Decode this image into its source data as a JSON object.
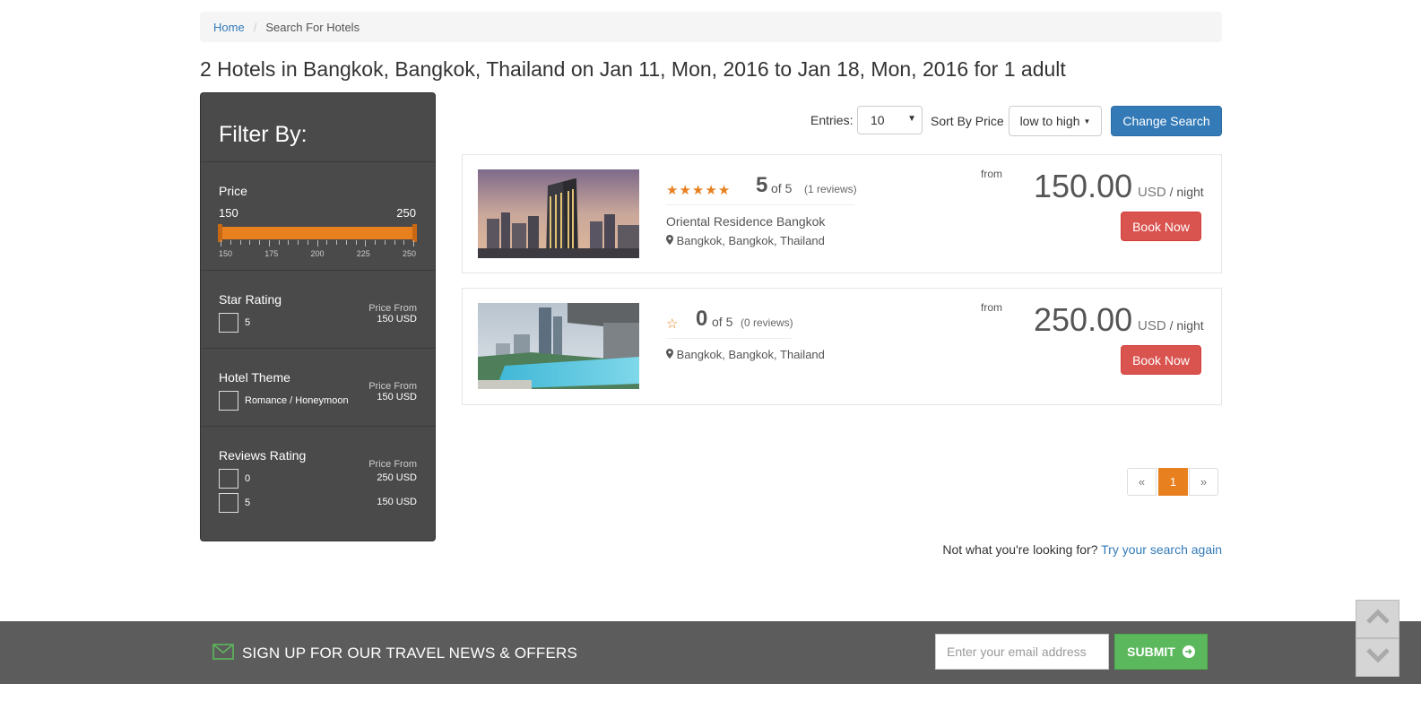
{
  "breadcrumb": {
    "home": "Home",
    "current": "Search For Hotels"
  },
  "page_title": "2 Hotels in Bangkok, Bangkok, Thailand on Jan 11, Mon, 2016 to Jan 18, Mon, 2016 for 1 adult",
  "filter": {
    "title": "Filter By:",
    "price": {
      "title": "Price",
      "min": "150",
      "max": "250",
      "ticks": [
        "150",
        "175",
        "200",
        "225",
        "250"
      ]
    },
    "star_rating": {
      "title": "Star Rating",
      "options": [
        {
          "label": "5",
          "price_from_label": "Price From",
          "price": "150 USD"
        }
      ]
    },
    "hotel_theme": {
      "title": "Hotel Theme",
      "options": [
        {
          "label": "Romance / Honeymoon",
          "price_from_label": "Price From",
          "price": "150 USD"
        }
      ]
    },
    "reviews_rating": {
      "title": "Reviews Rating",
      "price_from_label": "Price From",
      "options": [
        {
          "label": "0",
          "price": "250 USD"
        },
        {
          "label": "5",
          "price": "150 USD"
        }
      ]
    }
  },
  "toolbar": {
    "entries_label": "Entries:",
    "entries_value": "10",
    "sort_label": "Sort By Price",
    "sort_value": "low to high",
    "change_search": "Change Search"
  },
  "hotels": [
    {
      "stars": 5,
      "rating": "5",
      "rating_of": "of 5",
      "reviews": "(1 reviews)",
      "name": "Oriental Residence Bangkok",
      "location": "Bangkok, Bangkok, Thailand",
      "from_label": "from",
      "price": "150.00",
      "currency": "USD",
      "per": "/ night",
      "book": "Book Now"
    },
    {
      "stars": 0,
      "rating": "0",
      "rating_of": "of 5",
      "reviews": "(0 reviews)",
      "name": "",
      "location": "Bangkok, Bangkok, Thailand",
      "from_label": "from",
      "price": "250.00",
      "currency": "USD",
      "per": "/ night",
      "book": "Book Now"
    }
  ],
  "pagination": {
    "prev": "«",
    "current": "1",
    "next": "»"
  },
  "not_found": {
    "text": "Not what you're looking for?",
    "link": "Try your search again"
  },
  "newsletter": {
    "text": "SIGN UP FOR OUR TRAVEL NEWS & OFFERS",
    "placeholder": "Enter your email address",
    "submit": "SUBMIT"
  },
  "colors": {
    "accent": "#e8801f",
    "primary": "#337ab7",
    "danger": "#d9534f",
    "success": "#5cb85c",
    "sidebar": "#4a4a4a",
    "footer": "#5c5c5c"
  },
  "icons": [
    "map-marker-icon",
    "star-icon",
    "star-outline-icon",
    "envelope-icon",
    "arrow-circle-right-icon",
    "chevron-up-icon",
    "chevron-down-icon",
    "caret-down-icon"
  ]
}
